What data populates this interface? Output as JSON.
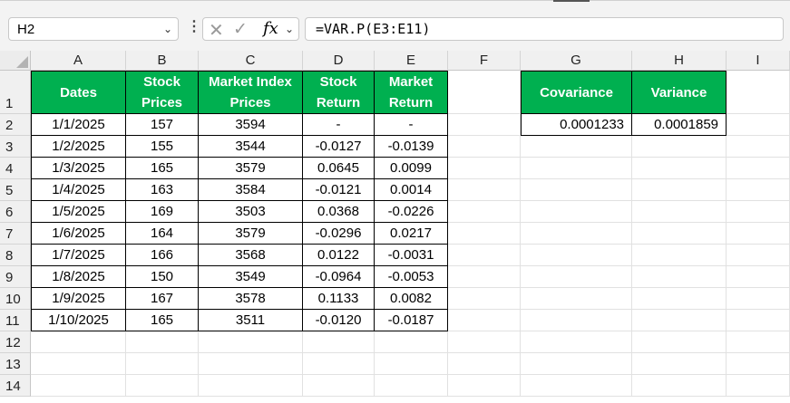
{
  "name_box": "H2",
  "formula": "=VAR.P(E3:E11)",
  "columns": [
    "A",
    "B",
    "C",
    "D",
    "E",
    "F",
    "G",
    "H",
    "I"
  ],
  "rows": [
    "1",
    "2",
    "3",
    "4",
    "5",
    "6",
    "7",
    "8",
    "9",
    "10",
    "11",
    "12",
    "13",
    "14"
  ],
  "table_headers": [
    [
      "Dates"
    ],
    [
      "Stock",
      "Prices"
    ],
    [
      "Market Index",
      "Prices"
    ],
    [
      "Stock",
      "Return"
    ],
    [
      "Market",
      "Return"
    ]
  ],
  "table_rows": [
    [
      "1/1/2025",
      "157",
      "3594",
      "-",
      "-"
    ],
    [
      "1/2/2025",
      "155",
      "3544",
      "-0.0127",
      "-0.0139"
    ],
    [
      "1/3/2025",
      "165",
      "3579",
      "0.0645",
      "0.0099"
    ],
    [
      "1/4/2025",
      "163",
      "3584",
      "-0.0121",
      "0.0014"
    ],
    [
      "1/5/2025",
      "169",
      "3503",
      "0.0368",
      "-0.0226"
    ],
    [
      "1/6/2025",
      "164",
      "3579",
      "-0.0296",
      "0.0217"
    ],
    [
      "1/7/2025",
      "166",
      "3568",
      "0.0122",
      "-0.0031"
    ],
    [
      "1/8/2025",
      "150",
      "3549",
      "-0.0964",
      "-0.0053"
    ],
    [
      "1/9/2025",
      "167",
      "3578",
      "0.1133",
      "0.0082"
    ],
    [
      "1/10/2025",
      "165",
      "3511",
      "-0.0120",
      "-0.0187"
    ]
  ],
  "summary": {
    "headers": [
      "Covariance",
      "Variance"
    ],
    "values": [
      "0.0001233",
      "0.0001859"
    ]
  },
  "colors": {
    "header_green": "#00b050",
    "header_text": "#ffffff"
  }
}
